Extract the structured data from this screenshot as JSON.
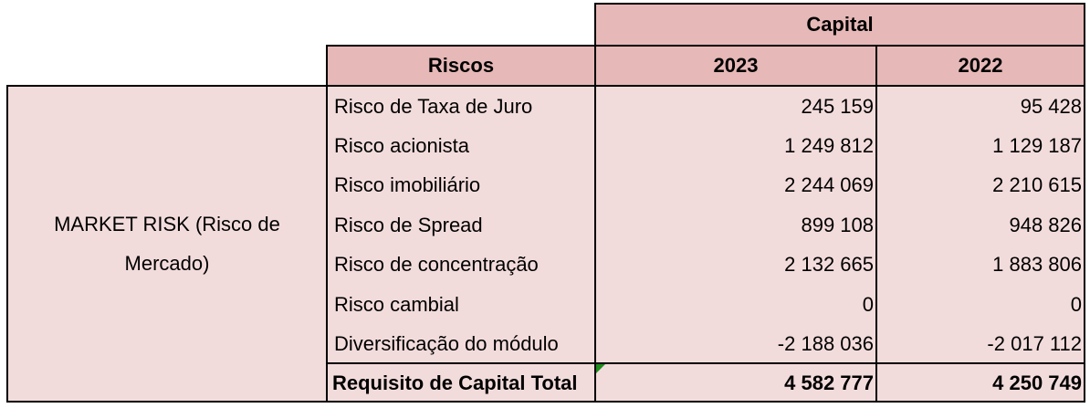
{
  "header": {
    "group_title": "Capital",
    "col_label": "Riscos",
    "year_1": "2023",
    "year_2": "2022"
  },
  "group": {
    "label": "MARKET RISK (Risco de Mercado)"
  },
  "rows": [
    {
      "label": "Risco de Taxa de Juro",
      "v2023": "245 159",
      "v2022": "95 428"
    },
    {
      "label": "Risco acionista",
      "v2023": "1 249 812",
      "v2022": "1 129 187"
    },
    {
      "label": "Risco imobiliário",
      "v2023": "2 244 069",
      "v2022": "2 210 615"
    },
    {
      "label": "Risco de Spread",
      "v2023": "899 108",
      "v2022": "948 826"
    },
    {
      "label": "Risco de concentração",
      "v2023": "2 132 665",
      "v2022": "1 883 806"
    },
    {
      "label": "Risco cambial",
      "v2023": "0",
      "v2022": "0"
    },
    {
      "label": "Diversificação do módulo",
      "v2023": "-2 188 036",
      "v2022": "-2 017 112"
    }
  ],
  "total": {
    "label": "Requisito de Capital Total",
    "v2023": "4 582 777",
    "v2022": "4 250 749"
  }
}
